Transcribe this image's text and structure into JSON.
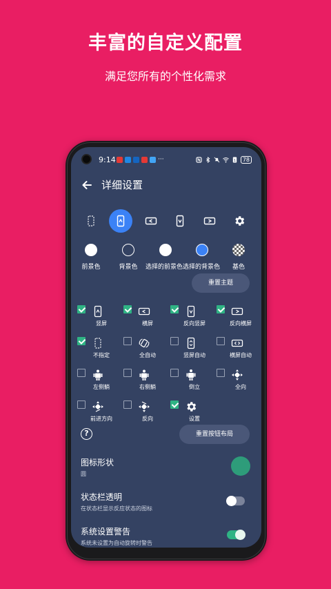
{
  "promo": {
    "title": "丰富的自定义配置",
    "subtitle": "满足您所有的个性化需求"
  },
  "status_bar": {
    "time": "9:14",
    "battery": "78",
    "notification_colors": [
      "#E53935",
      "#1E88E5",
      "#1565C0",
      "#E53935",
      "#42A5F5"
    ],
    "more": "···",
    "icons": [
      "nfc-icon",
      "bluetooth-icon",
      "mute-icon",
      "wifi-icon",
      "sim-icon",
      "battery-icon"
    ]
  },
  "app_bar": {
    "back_icon": "arrow-left-icon",
    "title": "详细设置"
  },
  "mode_icons": [
    {
      "name": "unspecified-icon",
      "active": false
    },
    {
      "name": "portrait-icon",
      "active": true
    },
    {
      "name": "landscape-icon",
      "active": false
    },
    {
      "name": "reverse-portrait-icon",
      "active": false
    },
    {
      "name": "reverse-landscape-icon",
      "active": false
    },
    {
      "name": "gear-icon",
      "active": false
    }
  ],
  "colors": [
    {
      "label": "前景色",
      "color": "#FFFFFF"
    },
    {
      "label": "背景色",
      "color": "#344262"
    },
    {
      "label": "选择的前景色",
      "color": "#FFFFFF"
    },
    {
      "label": "选择的背景色",
      "color": "#3B82F6"
    },
    {
      "label": "基色",
      "color": "checker"
    }
  ],
  "reset_theme_label": "重置主题",
  "options": [
    {
      "label": "竖屏",
      "checked": true,
      "icon": "portrait-icon"
    },
    {
      "label": "横屏",
      "checked": true,
      "icon": "landscape-icon"
    },
    {
      "label": "反向竖屏",
      "checked": true,
      "icon": "reverse-portrait-icon"
    },
    {
      "label": "反向横屏",
      "checked": true,
      "icon": "reverse-landscape-icon"
    },
    {
      "label": "不指定",
      "checked": true,
      "icon": "unspecified-icon"
    },
    {
      "label": "全自动",
      "checked": false,
      "icon": "auto-rotate-icon"
    },
    {
      "label": "竖屏自动",
      "checked": false,
      "icon": "portrait-auto-icon"
    },
    {
      "label": "横屏自动",
      "checked": false,
      "icon": "landscape-auto-icon"
    },
    {
      "label": "左侧躺",
      "checked": false,
      "icon": "lie-left-icon"
    },
    {
      "label": "右侧躺",
      "checked": false,
      "icon": "lie-right-icon"
    },
    {
      "label": "倒立",
      "checked": false,
      "icon": "upside-down-icon"
    },
    {
      "label": "全向",
      "checked": false,
      "icon": "omnidirectional-icon"
    },
    {
      "label": "前进方向",
      "checked": false,
      "icon": "forward-direction-icon"
    },
    {
      "label": "反向",
      "checked": false,
      "icon": "reverse-direction-icon"
    },
    {
      "label": "设置",
      "checked": true,
      "icon": "gear-icon"
    }
  ],
  "help_label": "?",
  "reset_layout_label": "重置按钮布局",
  "settings": {
    "icon_shape": {
      "title": "图标形状",
      "value": "圆"
    },
    "status_bar_transparent": {
      "title": "状态栏透明",
      "sub": "在状态栏显示反应状态的图标",
      "enabled": false
    },
    "system_warning": {
      "title": "系统设置警告",
      "sub": "系统未设置为自动旋转时警告",
      "enabled": true
    }
  }
}
